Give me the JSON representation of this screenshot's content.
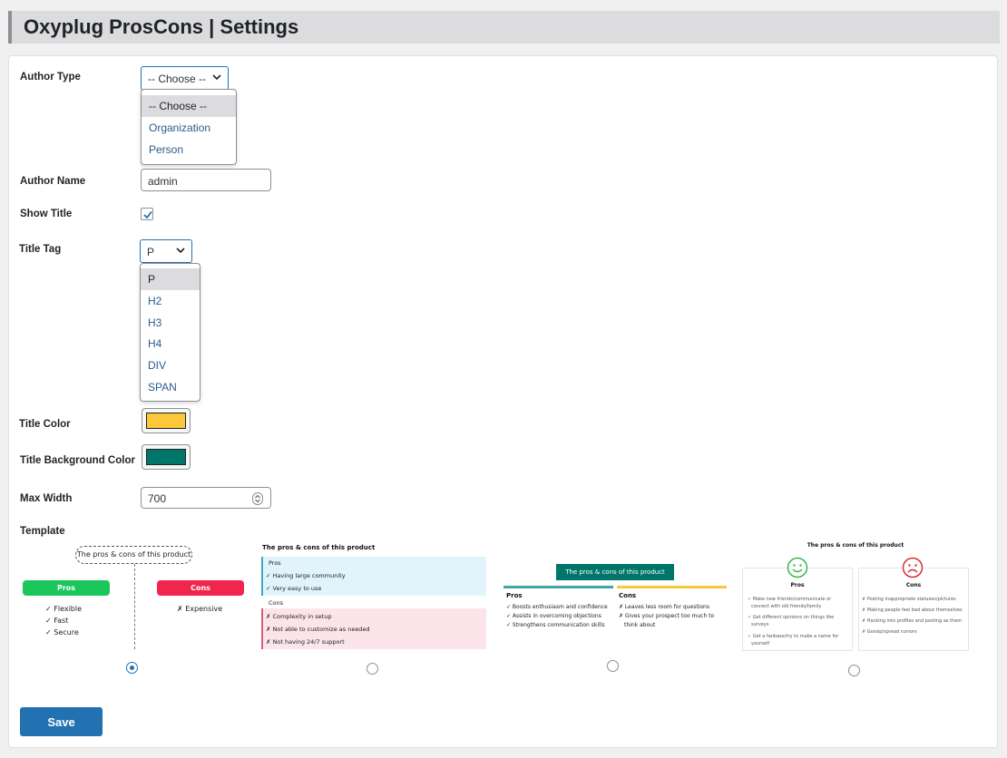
{
  "header": {
    "title": "Oxyplug ProsCons | Settings"
  },
  "form": {
    "author_type": {
      "label": "Author Type",
      "value": "-- Choose --",
      "options": [
        "-- Choose --",
        "Organization",
        "Person"
      ]
    },
    "author_name": {
      "label": "Author Name",
      "value": "admin"
    },
    "show_title": {
      "label": "Show Title",
      "checked": true
    },
    "title_tag": {
      "label": "Title Tag",
      "value": "P",
      "options": [
        "P",
        "H2",
        "H3",
        "H4",
        "DIV",
        "SPAN"
      ]
    },
    "title_color": {
      "label": "Title Color",
      "color": "#fbc937"
    },
    "title_bg_color": {
      "label": "Title Background Color",
      "color": "#00766a"
    },
    "max_width": {
      "label": "Max Width",
      "value": "700"
    },
    "template": {
      "label": "Template",
      "selected": 0
    },
    "save_label": "Save"
  },
  "templates": {
    "t1": {
      "title": "The pros & cons of this product",
      "pros_label": "Pros",
      "cons_label": "Cons",
      "pros": [
        "✓ Flexible",
        "✓ Fast",
        "✓ Secure"
      ],
      "cons": [
        "✗ Expensive"
      ],
      "pros_color": "#1bc65b",
      "cons_color": "#f0264f"
    },
    "t2": {
      "title": "The pros & cons of this product",
      "pros_label": "Pros",
      "cons_label": "Cons",
      "pros": [
        "✓ Having large community",
        "✓ Very easy to use"
      ],
      "cons": [
        "✗ Complexity in setup",
        "✗ Not able to customize as needed",
        "✗ Not having 24/7 support"
      ]
    },
    "t3": {
      "title": "The pros & cons of this product",
      "pros_label": "Pros",
      "cons_label": "Cons",
      "pros": [
        "✓ Boosts enthusiasm and confidence",
        "✓ Assists in overcoming objections",
        "✓ Strengthens communication skills"
      ],
      "cons": [
        "✗ Leaves less room for questions",
        "✗ Gives your prospect too much to",
        "think about"
      ]
    },
    "t4": {
      "title": "The pros & cons of this product",
      "pros_label": "Pros",
      "cons_label": "Cons",
      "pros": [
        "✓ Make new friends/communicate or",
        "connect with old friends/family",
        "✓ Get different opinions on things like",
        "surveys",
        "✓ Get a fanbase/try to make a name for",
        "yourself"
      ],
      "cons": [
        "✗ Posting inappropriate statuses/pictures",
        "✗ Making people feel bad about themselves",
        "✗ Hacking into profiles and posting as them",
        "✗ Gossip/spread rumors"
      ]
    }
  }
}
